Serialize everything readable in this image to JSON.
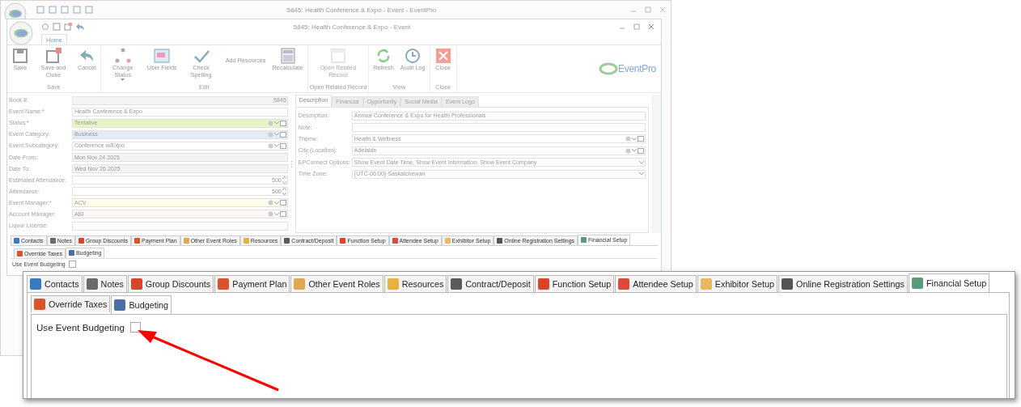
{
  "outer_window": {
    "title": "5845: Health Conference & Expo - Event - EventPro"
  },
  "window": {
    "title": "5845: Health Conference & Expo - Event",
    "ribbon_tabs": [
      {
        "label": "Home",
        "selected": true
      }
    ],
    "ribbon_groups": [
      {
        "label": "Save",
        "buttons": [
          {
            "label": "Save",
            "kind": "large",
            "disabled": false
          },
          {
            "label": "Save and Close",
            "kind": "large",
            "disabled": false
          },
          {
            "label": "Cancel",
            "kind": "large",
            "disabled": false
          }
        ]
      },
      {
        "label": "Edit",
        "buttons": [
          {
            "label": "Change Status",
            "kind": "dropdown",
            "disabled": false
          },
          {
            "label": "User Fields",
            "kind": "large",
            "disabled": false
          },
          {
            "label": "Check Spelling",
            "kind": "large",
            "disabled": false
          },
          {
            "label": "Add Resources",
            "kind": "small",
            "disabled": false
          },
          {
            "label": "Recalculate",
            "kind": "large",
            "disabled": false
          }
        ]
      },
      {
        "label": "Open Related Record",
        "buttons": [
          {
            "label": "Open Related Record",
            "kind": "large",
            "disabled": true
          }
        ]
      },
      {
        "label": "View",
        "buttons": [
          {
            "label": "Refresh",
            "kind": "large",
            "disabled": false
          },
          {
            "label": "Audit Log",
            "kind": "large",
            "disabled": false
          }
        ]
      },
      {
        "label": "Close",
        "buttons": [
          {
            "label": "Close",
            "kind": "large",
            "disabled": false
          }
        ]
      }
    ],
    "logo_text": "EventPro"
  },
  "form": {
    "fields": [
      {
        "label": "Book #:",
        "value": "5845",
        "kind": "readonly"
      },
      {
        "label": "Event Name:*",
        "value": "Health Conference & Expo",
        "kind": "text"
      },
      {
        "label": "Status:*",
        "value": "Tentative",
        "kind": "lookup",
        "color": "#e6f5c8"
      },
      {
        "label": "Event Category:",
        "value": "Business",
        "kind": "lookup",
        "color": "#e2ebf6"
      },
      {
        "label": "Event Subcategory:",
        "value": "Conference w/Expo",
        "kind": "lookup",
        "color": "#ffffff"
      },
      {
        "label": "Date From:",
        "value": "Mon Nov 24 2025",
        "kind": "readonly"
      },
      {
        "label": "Date To:",
        "value": "Wed Nov 26 2025",
        "kind": "readonly"
      },
      {
        "label": "Estimated Attendance:",
        "value": "500",
        "kind": "number"
      },
      {
        "label": "Attendance:",
        "value": "500",
        "kind": "number"
      },
      {
        "label": "Event Manager:*",
        "value": "ACV",
        "kind": "lookup",
        "color": "#fdfdea"
      },
      {
        "label": "Account Manager:",
        "value": "ABI",
        "kind": "lookup",
        "color": "#fcf6f6"
      },
      {
        "label": "Liquor License:",
        "kind": "text"
      }
    ]
  },
  "detail_tabs": [
    {
      "label": "Description",
      "selected": true
    },
    {
      "label": "Financial",
      "selected": false
    },
    {
      "label": "Opportunity",
      "selected": false
    },
    {
      "label": "Social Media",
      "selected": false
    },
    {
      "label": "Event Logo",
      "selected": false
    }
  ],
  "detail_fields": [
    {
      "label": "Description:",
      "value": "Annual Conference & Expo for Health Professionals",
      "kind": "text"
    },
    {
      "label": "Note:",
      "kind": "text"
    },
    {
      "label": "Theme:",
      "value": "Health & Wellness",
      "kind": "lookup"
    },
    {
      "label": "City (Location):",
      "value": "Adelaide",
      "kind": "lookup"
    },
    {
      "label": "EPConnect Options:",
      "value": "Show Event Date Time, Show Event Information, Show Event Company",
      "kind": "combo"
    },
    {
      "label": "Time Zone:",
      "value": "(UTC-06:00) Saskatchewan",
      "kind": "combo"
    }
  ],
  "bottom_tabs": [
    {
      "label": "Contacts",
      "selected": false,
      "color": "#3a78c2"
    },
    {
      "label": "Notes",
      "selected": false,
      "color": "#6a6a6a"
    },
    {
      "label": "Group Discounts",
      "selected": false,
      "color": "#d9452b"
    },
    {
      "label": "Payment Plan",
      "selected": false,
      "color": "#d9542b"
    },
    {
      "label": "Other Event Roles",
      "selected": false,
      "color": "#e0a850"
    },
    {
      "label": "Resources",
      "selected": false,
      "color": "#e8b040"
    },
    {
      "label": "Contract/Deposit",
      "selected": false,
      "color": "#5a5a5a"
    },
    {
      "label": "Function Setup",
      "selected": false,
      "color": "#d9452b"
    },
    {
      "label": "Attendee Setup",
      "selected": false,
      "color": "#d94a3b"
    },
    {
      "label": "Exhibitor Setup",
      "selected": false,
      "color": "#e8b860"
    },
    {
      "label": "Online Registration Settings",
      "selected": false,
      "color": "#555555"
    },
    {
      "label": "Financial Setup",
      "selected": true,
      "color": "#5a9a7a"
    }
  ],
  "sub_tabs": [
    {
      "label": "Override Taxes",
      "selected": false,
      "color": "#d9542b"
    },
    {
      "label": "Budgeting",
      "selected": true,
      "color": "#4a6fa5"
    }
  ],
  "budgeting_option": {
    "label": "Use Event Budgeting",
    "checked": false
  },
  "zoom_callout": {
    "tabs": [
      {
        "label": "Contacts",
        "selected": false,
        "color": "#3a78c2"
      },
      {
        "label": "Notes",
        "selected": false,
        "color": "#6a6a6a"
      },
      {
        "label": "Group Discounts",
        "selected": false,
        "color": "#d9452b"
      },
      {
        "label": "Payment Plan",
        "selected": false,
        "color": "#d9542b"
      },
      {
        "label": "Other Event Roles",
        "selected": false,
        "color": "#e0a850"
      },
      {
        "label": "Resources",
        "selected": false,
        "color": "#e8b040"
      },
      {
        "label": "Contract/Deposit",
        "selected": false,
        "color": "#5a5a5a"
      },
      {
        "label": "Function Setup",
        "selected": false,
        "color": "#d9452b"
      },
      {
        "label": "Attendee Setup",
        "selected": false,
        "color": "#d94a3b"
      },
      {
        "label": "Exhibitor Setup",
        "selected": false,
        "color": "#e8b860"
      },
      {
        "label": "Online Registration Settings",
        "selected": false,
        "color": "#555555"
      },
      {
        "label": "Financial Setup",
        "selected": true,
        "color": "#5a9a7a"
      }
    ],
    "sub_tabs": [
      {
        "label": "Override Taxes",
        "selected": false,
        "color": "#d9542b"
      },
      {
        "label": "Budgeting",
        "selected": true,
        "color": "#4a6fa5"
      }
    ],
    "budgeting_option": {
      "label": "Use Event Budgeting",
      "checked": false
    }
  }
}
